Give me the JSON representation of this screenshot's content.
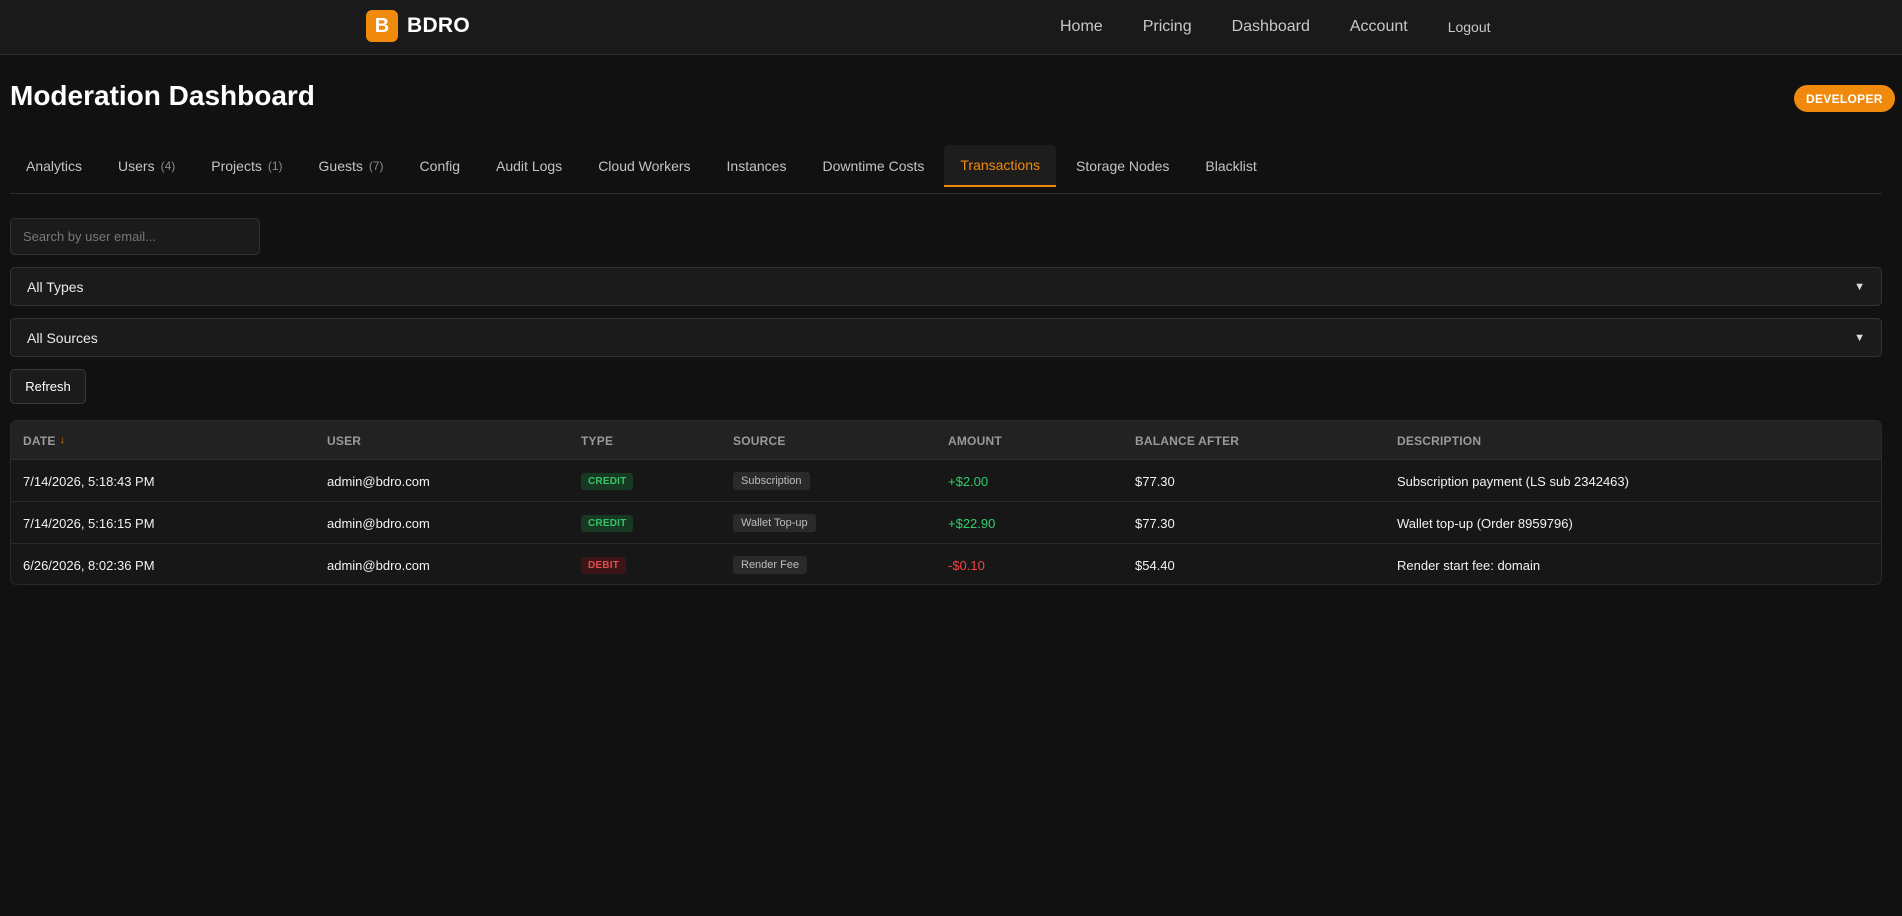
{
  "brand": {
    "logo_letter": "B",
    "name": "BDRO"
  },
  "nav": {
    "home": "Home",
    "pricing": "Pricing",
    "dashboard": "Dashboard",
    "account": "Account",
    "logout": "Logout"
  },
  "header": {
    "title": "Moderation Dashboard",
    "role_badge": "DEVELOPER"
  },
  "tabs": [
    {
      "label": "Analytics",
      "count": ""
    },
    {
      "label": "Users",
      "count": "(4)"
    },
    {
      "label": "Projects",
      "count": "(1)"
    },
    {
      "label": "Guests",
      "count": "(7)"
    },
    {
      "label": "Config",
      "count": ""
    },
    {
      "label": "Audit Logs",
      "count": ""
    },
    {
      "label": "Cloud Workers",
      "count": ""
    },
    {
      "label": "Instances",
      "count": ""
    },
    {
      "label": "Downtime Costs",
      "count": ""
    },
    {
      "label": "Transactions",
      "count": "",
      "active": true
    },
    {
      "label": "Storage Nodes",
      "count": ""
    },
    {
      "label": "Blacklist",
      "count": ""
    }
  ],
  "filters": {
    "search_placeholder": "Search by user email...",
    "search_value": "",
    "type_selected": "All Types",
    "source_selected": "All Sources",
    "refresh_label": "Refresh"
  },
  "table": {
    "columns": {
      "date": "DATE",
      "user": "USER",
      "type": "TYPE",
      "source": "SOURCE",
      "amount": "AMOUNT",
      "balance_after": "BALANCE AFTER",
      "description": "DESCRIPTION"
    },
    "sort_indicator": "↓",
    "rows": [
      {
        "date": "7/14/2026, 5:18:43 PM",
        "user": "admin@bdro.com",
        "type": "CREDIT",
        "source": "Subscription",
        "amount": "+$2.00",
        "balance_after": "$77.30",
        "description": "Subscription payment (LS sub 2342463)"
      },
      {
        "date": "7/14/2026, 5:16:15 PM",
        "user": "admin@bdro.com",
        "type": "CREDIT",
        "source": "Wallet Top-up",
        "amount": "+$22.90",
        "balance_after": "$77.30",
        "description": "Wallet top-up (Order 8959796)"
      },
      {
        "date": "6/26/2026, 8:02:36 PM",
        "user": "admin@bdro.com",
        "type": "DEBIT",
        "source": "Render Fee",
        "amount": "-$0.10",
        "balance_after": "$54.40",
        "description": "Render start fee: domain"
      }
    ]
  },
  "colors": {
    "accent": "#f08a0c",
    "credit": "#39c266",
    "debit": "#e24b4b",
    "background": "#111111"
  }
}
